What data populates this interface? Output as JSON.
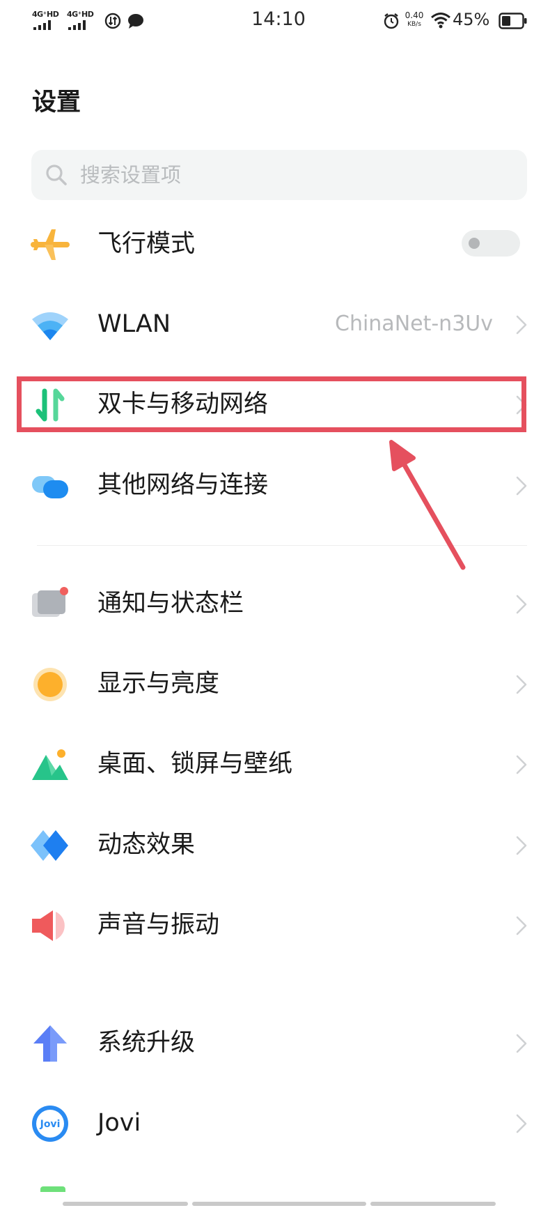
{
  "status_bar": {
    "network_1": "4G⁺HD",
    "network_2": "4G⁺HD",
    "time": "14:10",
    "speed_value": "0.40",
    "speed_unit": "KB/s",
    "battery_percent": "45%",
    "battery_level": 0.45
  },
  "page": {
    "title": "设置"
  },
  "search": {
    "placeholder": "搜索设置项"
  },
  "settings_items": [
    {
      "label": "飞行模式",
      "icon": "airplane-icon",
      "toggle_on": false
    },
    {
      "label": "WLAN",
      "icon": "wifi-icon",
      "value": "ChinaNet-n3Uv"
    },
    {
      "label": "双卡与移动网络",
      "icon": "dual-sim-icon"
    },
    {
      "label": "其他网络与连接",
      "icon": "connection-icon"
    },
    {
      "label": "通知与状态栏",
      "icon": "notification-icon"
    },
    {
      "label": "显示与亮度",
      "icon": "brightness-icon"
    },
    {
      "label": "桌面、锁屏与壁纸",
      "icon": "wallpaper-icon"
    },
    {
      "label": "动态效果",
      "icon": "animation-icon"
    },
    {
      "label": "声音与振动",
      "icon": "sound-icon"
    },
    {
      "label": "系统升级",
      "icon": "upgrade-icon"
    },
    {
      "label": "Jovi",
      "icon": "jovi-icon",
      "icon_text": "Jovi"
    }
  ],
  "colors": {
    "annotation": "#e5505e",
    "chevron": "#cfd1d3",
    "secondary_text": "#b7b9bb"
  }
}
